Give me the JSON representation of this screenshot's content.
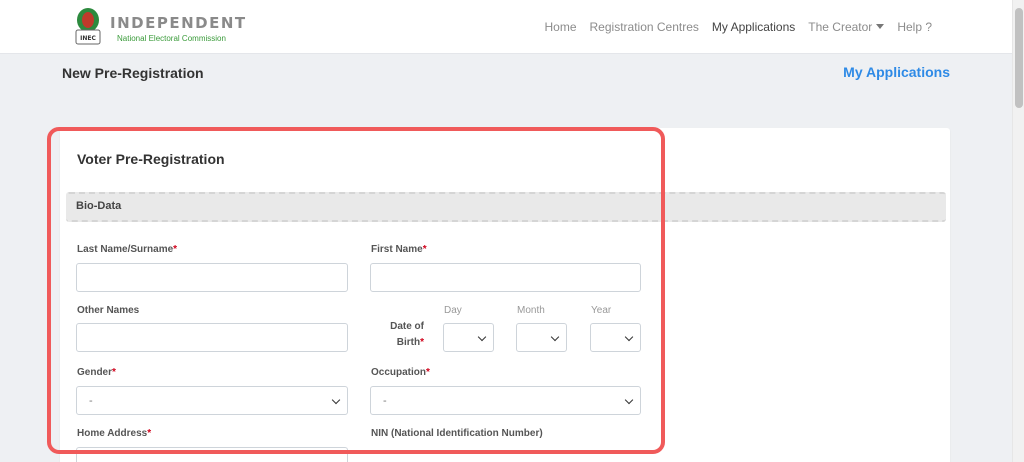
{
  "brand": {
    "title": "INDEPENDENT",
    "subtitle": "National Electoral Commission",
    "emblem_text": "INEC"
  },
  "nav": {
    "items": [
      {
        "label": "Home"
      },
      {
        "label": "Registration Centres"
      },
      {
        "label": "My Applications"
      },
      {
        "label": "The Creator"
      },
      {
        "label": "Help ?"
      }
    ],
    "active_item": "My Applications"
  },
  "header": {
    "page_title": "New Pre-Registration",
    "my_applications_link": "My Applications"
  },
  "form": {
    "title": "Voter Pre-Registration",
    "section": "Bio-Data",
    "required_mark": "*",
    "last_name_label": "Last Name/Surname",
    "first_name_label": "First Name",
    "other_names_label": "Other Names",
    "dob_label": "Date of Birth",
    "dob_day_label": "Day",
    "dob_month_label": "Month",
    "dob_year_label": "Year",
    "gender_label": "Gender",
    "gender_value": "-",
    "occupation_label": "Occupation",
    "occupation_value": "-",
    "home_address_label": "Home Address",
    "nin_label": "NIN (National Identification Number)"
  },
  "colors": {
    "accent_link": "#2e8ae6",
    "highlight_border": "#f05a5a",
    "required_marker": "#d0021b",
    "brand_green": "#3a9b3a"
  }
}
